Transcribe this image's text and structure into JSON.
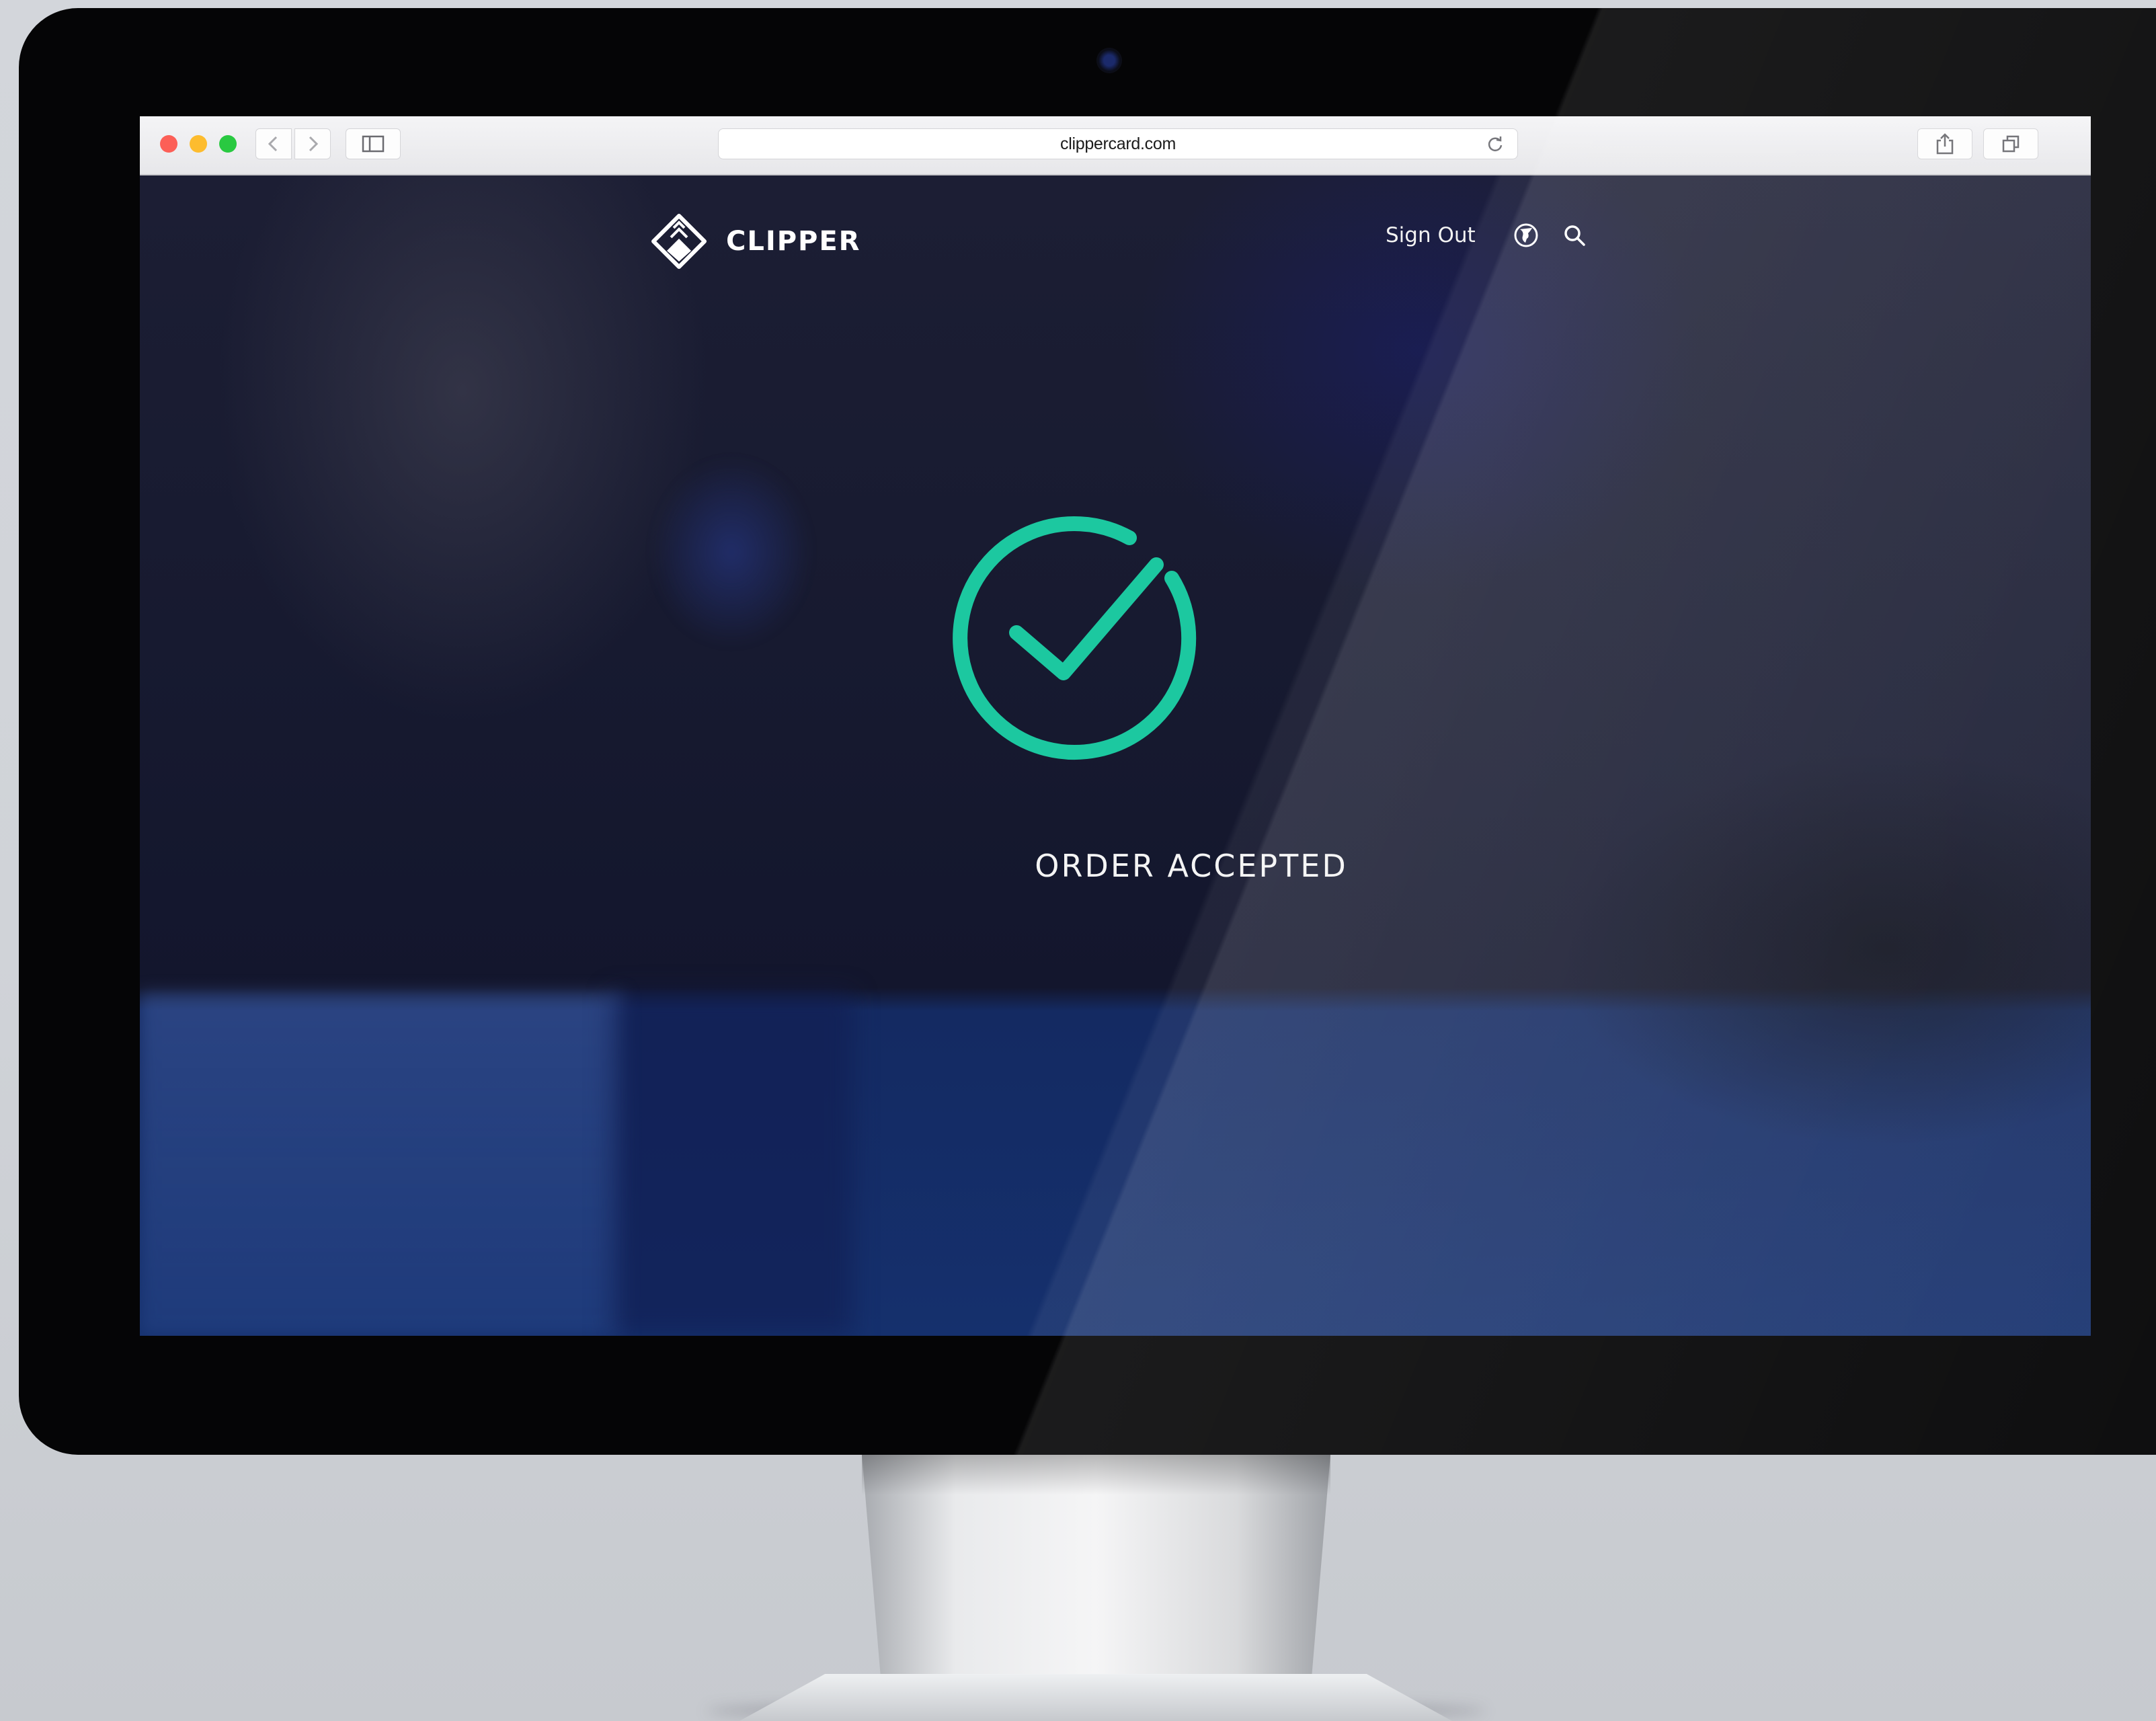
{
  "browser": {
    "url": "clippercard.com",
    "window_controls": [
      "close",
      "minimize",
      "zoom"
    ],
    "toolbar_icons": [
      "back-icon",
      "forward-icon",
      "sidebar-icon",
      "reload-icon",
      "share-icon",
      "tabs-icon"
    ]
  },
  "site": {
    "brand": "CLIPPER",
    "nav": {
      "sign_out": "Sign Out",
      "icons": [
        "globe-icon",
        "search-icon"
      ]
    }
  },
  "status": {
    "message": "ORDER ACCEPTED",
    "icon": "check-circle-icon",
    "accent_color": "#1cc8a0"
  }
}
